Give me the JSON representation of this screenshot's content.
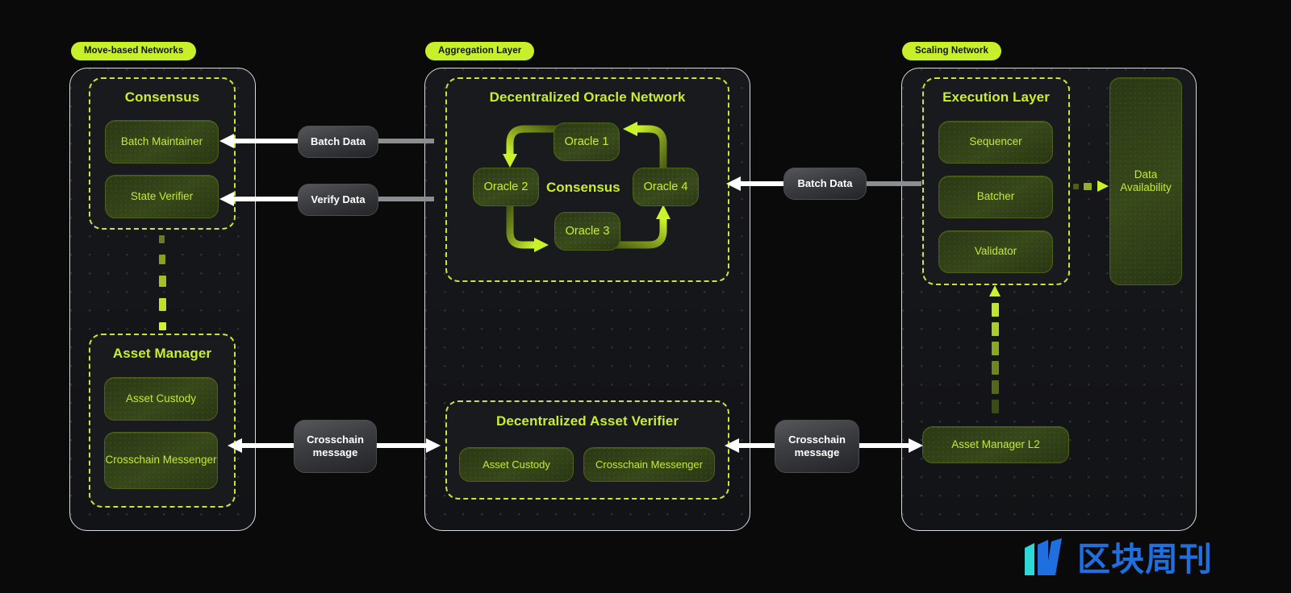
{
  "diagram": {
    "background": "#0a0a0b",
    "accent": "#c9ef2b",
    "badge_color": "#c8f02a",
    "panel_border": "#d9dadd"
  },
  "sections": [
    {
      "id": "move",
      "badge": "Move-based Networks",
      "groups": [
        {
          "title": "Consensus",
          "nodes": [
            {
              "label": "Batch Maintainer"
            },
            {
              "label": "State Verifier"
            }
          ]
        },
        {
          "title": "Asset Manager",
          "nodes": [
            {
              "label": "Asset Custody"
            },
            {
              "label": "Crosschain Messenger"
            }
          ]
        }
      ]
    },
    {
      "id": "aggregation",
      "badge": "Aggregation Layer",
      "groups": [
        {
          "title": "Decentralized Oracle Network",
          "center_label": "Consensus",
          "nodes": [
            {
              "label": "Oracle 1"
            },
            {
              "label": "Oracle 2"
            },
            {
              "label": "Oracle 3"
            },
            {
              "label": "Oracle 4"
            }
          ]
        },
        {
          "title": "Decentralized Asset Verifier",
          "nodes": [
            {
              "label": "Asset Custody"
            },
            {
              "label": "Crosschain Messenger"
            }
          ]
        }
      ]
    },
    {
      "id": "scaling",
      "badge": "Scaling Network",
      "groups": [
        {
          "title": "Execution Layer",
          "nodes": [
            {
              "label": "Sequencer"
            },
            {
              "label": "Batcher"
            },
            {
              "label": "Validator"
            }
          ]
        }
      ],
      "standalone_nodes": [
        {
          "label": "Data Availability"
        },
        {
          "label": "Asset Manager L2"
        }
      ]
    }
  ],
  "connectors": [
    {
      "id": "batch-data-left",
      "label": "Batch Data",
      "direction": "left"
    },
    {
      "id": "verify-data-left",
      "label": "Verify Data",
      "direction": "left"
    },
    {
      "id": "batch-data-right",
      "label": "Batch Data",
      "direction": "left"
    },
    {
      "id": "crosschain-message-left",
      "label": "Crosschain message",
      "direction": "both"
    },
    {
      "id": "crosschain-message-right",
      "label": "Crosschain message",
      "direction": "both"
    }
  ],
  "watermark": {
    "text": "区块周刊",
    "color": "#1f6fe0",
    "mark_color": "#2fd8d8"
  }
}
